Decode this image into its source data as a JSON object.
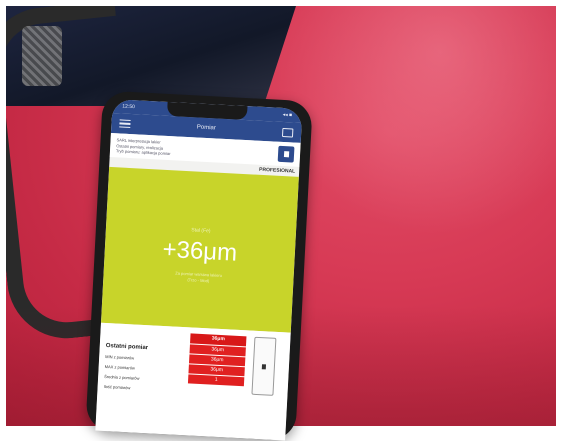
{
  "photo": {
    "background_color": "#d73a55"
  },
  "phone": {
    "status": {
      "time": "12:50",
      "indicators": "◂◂ ■"
    },
    "appbar": {
      "title": "Pomiar"
    },
    "info_lines": [
      "SARL interpretacja lakier",
      "Ostatni pomiary, realizacja",
      "Tryb pomiaru: aplikacja pomiar"
    ],
    "badge": "PROFESIONAL",
    "result": {
      "label": "Stal (Fe)",
      "value": "+36μm",
      "description_line1": "Za pomiar warstwa lakieru",
      "description_line2": "(Trzo - Mod)",
      "color": "#c8d42a"
    },
    "stats": {
      "heading": "Ostatni pomiar",
      "rows": [
        {
          "label": "MIN z pomiarów",
          "value": "36μm"
        },
        {
          "label": "MAX z pomiarów",
          "value": "36μm"
        },
        {
          "label": "Średnia z pomiarów",
          "value": "36μm"
        },
        {
          "label": "Ilość pomiarów",
          "value": "1"
        }
      ],
      "top_value": "36μm",
      "accent_color": "#e02020"
    }
  }
}
